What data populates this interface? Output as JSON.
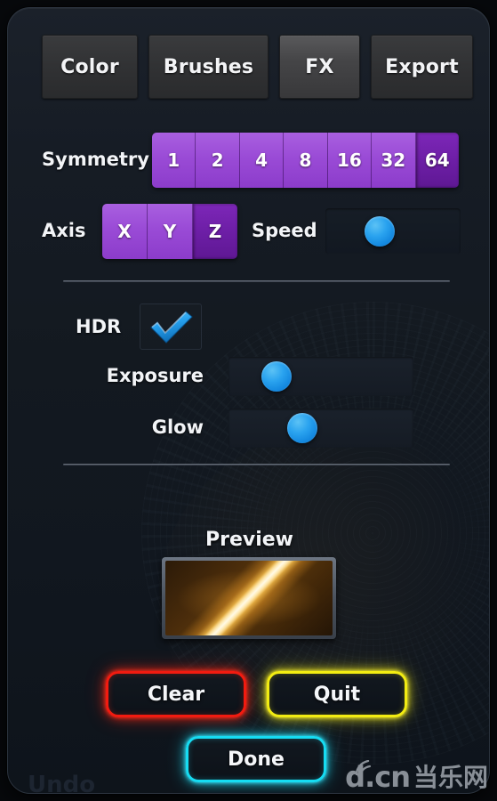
{
  "panel": {
    "tabs": [
      {
        "label": "Color",
        "active": false
      },
      {
        "label": "Brushes",
        "active": false
      },
      {
        "label": "FX",
        "active": true
      },
      {
        "label": "Export",
        "active": false
      }
    ],
    "symmetry": {
      "label": "Symmetry",
      "options": [
        "1",
        "2",
        "4",
        "8",
        "16",
        "32",
        "64"
      ],
      "selected": "64"
    },
    "axis": {
      "label": "Axis",
      "options": [
        "X",
        "Y",
        "Z"
      ],
      "selected": "Z"
    },
    "speed": {
      "label": "Speed",
      "knob_percent": 40
    },
    "hdr": {
      "label": "HDR",
      "checked": true,
      "check_icon": "checkmark-icon"
    },
    "exposure": {
      "label": "Exposure",
      "knob_percent": 26
    },
    "glow": {
      "label": "Glow",
      "knob_percent": 40
    },
    "preview": {
      "label": "Preview"
    },
    "actions": {
      "clear": {
        "label": "Clear",
        "color": "#f21b10"
      },
      "quit": {
        "label": "Quit",
        "color": "#f2ec12"
      },
      "done": {
        "label": "Done",
        "color": "#16dcf2"
      }
    },
    "undo": {
      "label": "Undo"
    }
  },
  "watermark": {
    "latin": "d.cn",
    "cjk": "当乐网",
    "wave_icon": "signal-wave-icon"
  },
  "colors": {
    "segment_normal": "#9a4bd6",
    "segment_selected": "#6d1ea6",
    "knob_blue": "#2aa3ef",
    "panel_bg": "#131920"
  }
}
